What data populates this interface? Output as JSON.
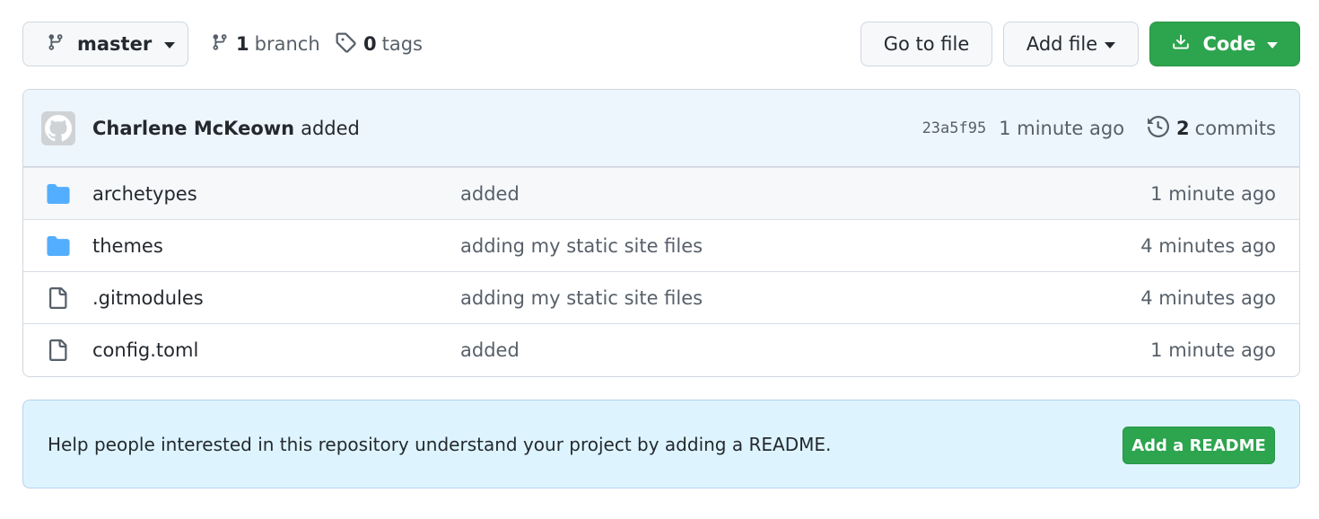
{
  "toolbar": {
    "branch_button": {
      "label": "master",
      "icon": "git-branch-icon"
    },
    "branches": {
      "count": "1",
      "label": "branch",
      "icon": "git-branch-icon"
    },
    "tags": {
      "count": "0",
      "label": "tags",
      "icon": "tag-icon"
    },
    "go_to_file": "Go to file",
    "add_file": "Add file",
    "code": {
      "label": "Code",
      "icon": "download-icon"
    }
  },
  "commit": {
    "author": "Charlene McKeown",
    "message": "added",
    "sha": "23a5f95",
    "time": "1 minute ago",
    "commits_count": "2",
    "commits_label": "commits"
  },
  "files": [
    {
      "type": "folder",
      "name": "archetypes",
      "message": "added",
      "age": "1 minute ago"
    },
    {
      "type": "folder",
      "name": "themes",
      "message": "adding my static site files",
      "age": "4 minutes ago"
    },
    {
      "type": "file",
      "name": ".gitmodules",
      "message": "adding my static site files",
      "age": "4 minutes ago"
    },
    {
      "type": "file",
      "name": "config.toml",
      "message": "added",
      "age": "1 minute ago"
    }
  ],
  "readme": {
    "text": "Help people interested in this repository understand your project by adding a README.",
    "button": "Add a README"
  },
  "colors": {
    "primary_green": "#2da44e",
    "folder_blue": "#54aeff",
    "commit_bar_bg": "#eef6fd",
    "readme_bg": "#ddf4ff"
  }
}
